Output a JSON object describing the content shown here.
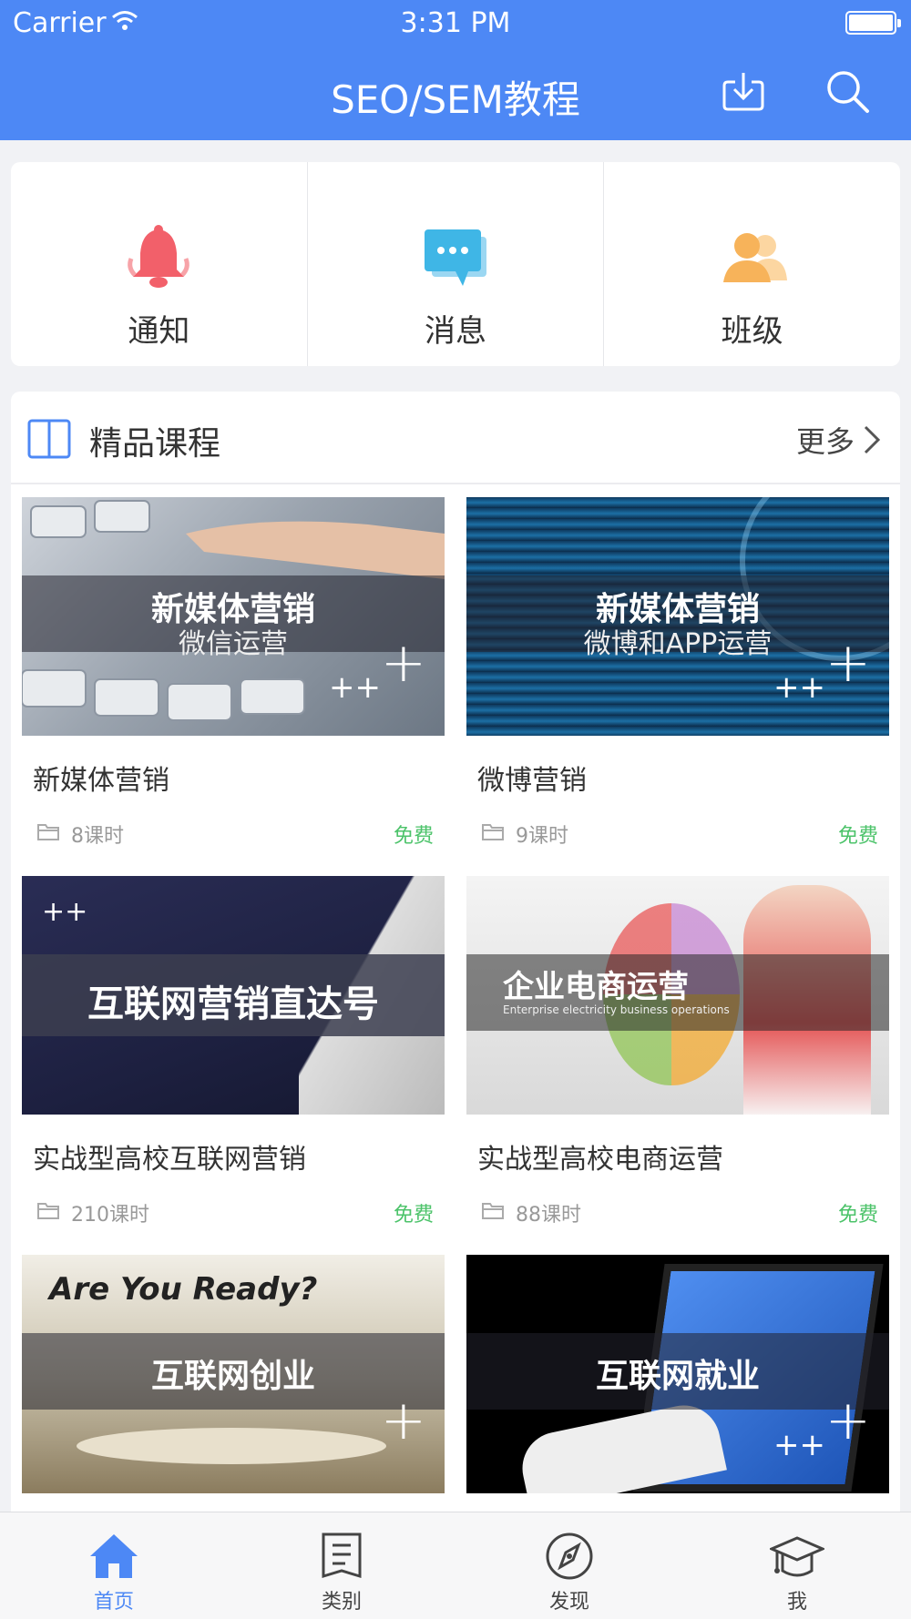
{
  "status": {
    "carrier": "Carrier",
    "time": "3:31 PM"
  },
  "header": {
    "title": "SEO/SEM教程",
    "download_icon": "download-icon",
    "search_icon": "search-icon"
  },
  "quick_actions": [
    {
      "label": "通知",
      "icon": "bell-icon",
      "color": "#f2606a"
    },
    {
      "label": "消息",
      "icon": "chat-icon",
      "color": "#3fb6e6"
    },
    {
      "label": "班级",
      "icon": "group-icon",
      "color": "#f7b35a"
    }
  ],
  "section": {
    "title": "精品课程",
    "more": "更多"
  },
  "courses": [
    {
      "thumb_title": "新媒体营销",
      "thumb_subtitle": "微信运营",
      "name": "新媒体营销",
      "lessons": "8课时",
      "price": "免费"
    },
    {
      "thumb_title": "新媒体营销",
      "thumb_subtitle": "微博和APP运营",
      "name": "微博营销",
      "lessons": "9课时",
      "price": "免费"
    },
    {
      "thumb_title": "互联网营销直达号",
      "thumb_subtitle": "",
      "name": "实战型高校互联网营销",
      "lessons": "210课时",
      "price": "免费"
    },
    {
      "thumb_title": "企业电商运营",
      "thumb_subtitle": "Enterprise electricity business operations",
      "name": "实战型高校电商运营",
      "lessons": "88课时",
      "price": "免费"
    },
    {
      "thumb_title": "互联网创业",
      "thumb_subtitle": "Are You Ready?",
      "name": "",
      "lessons": "",
      "price": ""
    },
    {
      "thumb_title": "互联网就业",
      "thumb_subtitle": "",
      "name": "",
      "lessons": "",
      "price": ""
    }
  ],
  "tabs": [
    {
      "label": "首页",
      "icon": "home-icon",
      "active": true
    },
    {
      "label": "类别",
      "icon": "list-icon",
      "active": false
    },
    {
      "label": "发现",
      "icon": "compass-icon",
      "active": false
    },
    {
      "label": "我",
      "icon": "graduation-cap-icon",
      "active": false
    }
  ],
  "colors": {
    "primary": "#4d88f5",
    "free": "#4cc36a"
  }
}
